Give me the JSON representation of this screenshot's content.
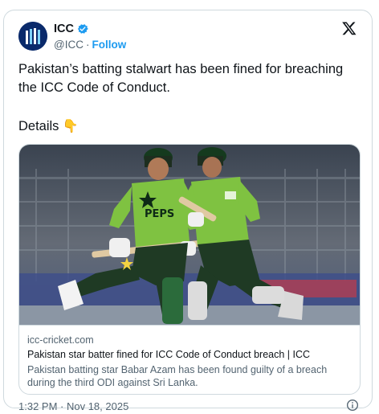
{
  "account": {
    "display_name": "ICC",
    "handle": "@ICC",
    "separator": "·",
    "follow_label": "Follow",
    "avatar_icon": "icc-logo",
    "verified_icon": "verified-badge-icon"
  },
  "tweet": {
    "text": "Pakistan’s batting stalwart has been fined for breaching the ICC Code of Conduct.",
    "details_label": "Details",
    "details_emoji": "👇",
    "timestamp": "1:32 PM · Nov 18, 2025"
  },
  "link_card": {
    "domain": "icc-cricket.com",
    "title": "Pakistan star batter fined for ICC Code of Conduct breach | ICC",
    "description": "Pakistan batting star Babar Azam has been found guilty of a breach during the third ODI against Sri Lanka."
  },
  "photo": {
    "jersey_text": "PEPS"
  },
  "colors": {
    "accent": "#1d9bf0",
    "text": "#0f1419",
    "muted": "#536471",
    "border": "#cfd9de",
    "jersey": "#7fc241",
    "kit_dark": "#1f3a24"
  }
}
